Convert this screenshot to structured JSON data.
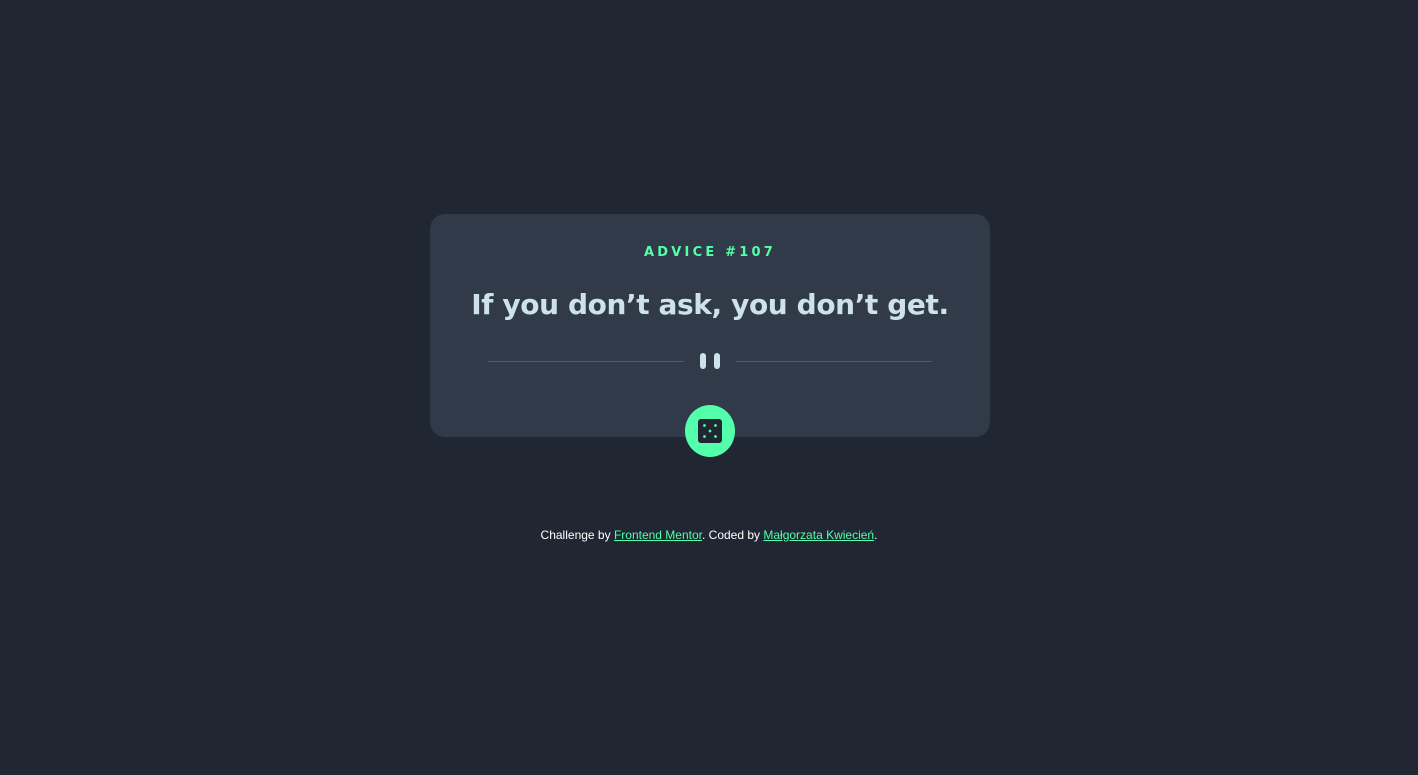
{
  "card": {
    "advice_label": "ADVICE #107",
    "quote": "If you don’t ask, you don’t get."
  },
  "dice_button": {
    "icon": "dice-icon"
  },
  "footer": {
    "prefix": "Challenge by ",
    "link1": "Frontend Mentor",
    "middle": ". Coded by ",
    "link2": "Małgorzata Kwiecień",
    "suffix": "."
  },
  "colors": {
    "background": "#202733",
    "card": "#313a48",
    "accent": "#53ffaa",
    "quote_text": "#cee3e9",
    "divider_line": "#4f5d74"
  }
}
